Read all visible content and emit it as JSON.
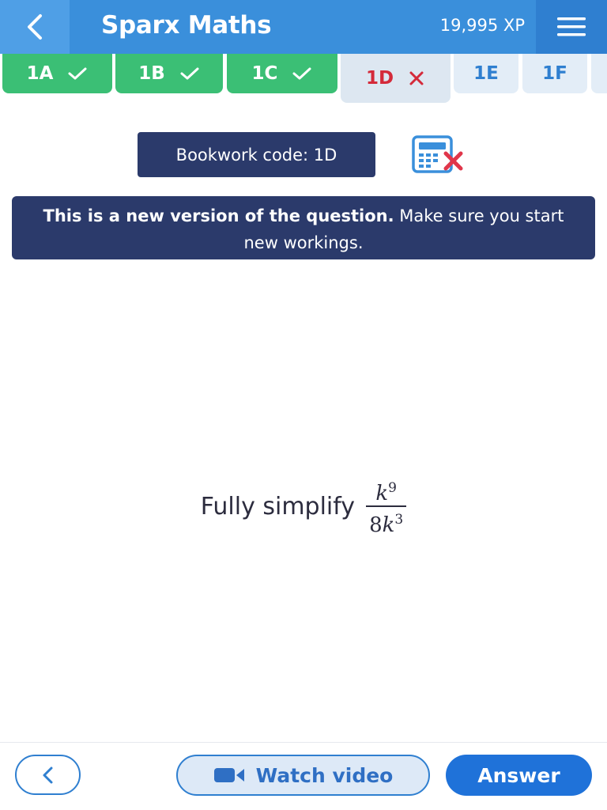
{
  "header": {
    "title": "Sparx Maths",
    "xp": "19,995 XP",
    "back_icon": "chevron-left-icon",
    "menu_icon": "hamburger-menu-icon"
  },
  "tabs": [
    {
      "label": "1A",
      "status": "correct"
    },
    {
      "label": "1B",
      "status": "correct"
    },
    {
      "label": "1C",
      "status": "correct"
    },
    {
      "label": "1D",
      "status": "incorrect"
    },
    {
      "label": "1E",
      "status": "pending"
    },
    {
      "label": "1F",
      "status": "pending"
    }
  ],
  "bookwork": {
    "label": "Bookwork code: 1D"
  },
  "notice": {
    "bold": "This is a new version of the question.",
    "rest": " Make sure you start new workings."
  },
  "question": {
    "text": "Fully simplify",
    "numerator_var": "k",
    "numerator_exp": "9",
    "denominator_coef": "8",
    "denominator_var": "k",
    "denominator_exp": "3"
  },
  "footer": {
    "watch_label": "Watch video",
    "answer_label": "Answer"
  },
  "colors": {
    "header": "#3a8fdb",
    "correct": "#3bbf75",
    "incorrect": "#d42a3a",
    "navy": "#2b3a6b",
    "primary": "#1f72d9"
  }
}
